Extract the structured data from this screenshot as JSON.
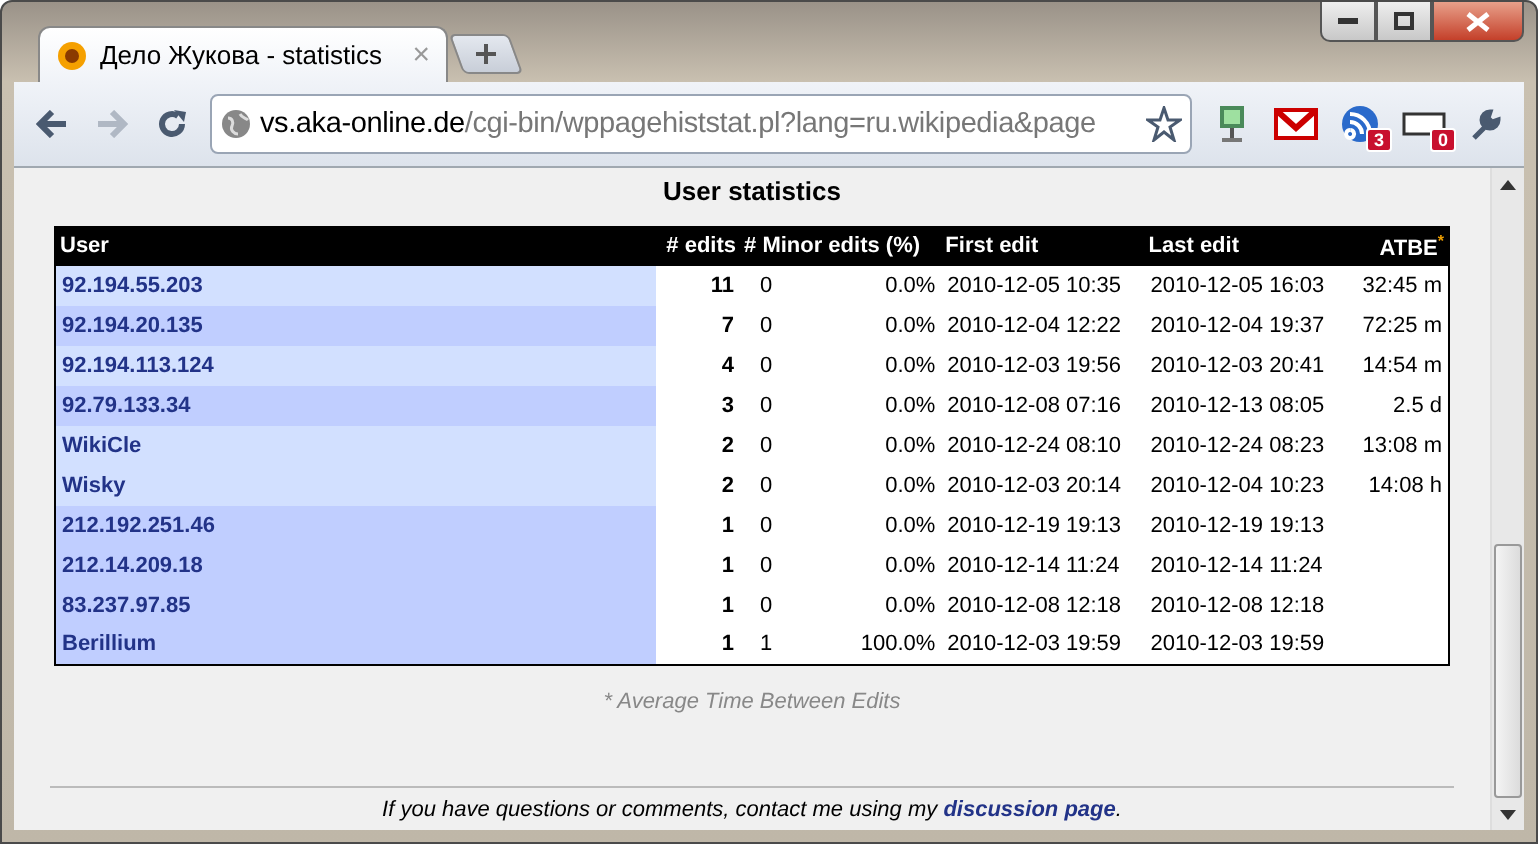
{
  "tab": {
    "title": "Дело Жукова - statistics",
    "close": "×"
  },
  "address": {
    "host": "vs.aka-online.de",
    "path": "/cgi-bin/wppagehiststat.pl?lang=ru.wikipedia&page"
  },
  "extensions": [
    {
      "kind": "monitor"
    },
    {
      "kind": "mail"
    },
    {
      "kind": "feed",
      "badge": "3"
    },
    {
      "kind": "counter",
      "badge": "0"
    }
  ],
  "heading": "User statistics",
  "table": {
    "columns": [
      "User",
      "# edits",
      "# Minor edits (%)",
      "First edit",
      "Last edit",
      "ATBE"
    ],
    "atbe_mark": "*",
    "rows": [
      {
        "user": "92.194.55.203",
        "edits": "11",
        "minor": "0",
        "percent": "0.0%",
        "first": "2010-12-05 10:35",
        "last": "2010-12-05 16:03",
        "atbe": "32:45 m",
        "highlighted": true
      },
      {
        "user": "92.194.20.135",
        "edits": "7",
        "minor": "0",
        "percent": "0.0%",
        "first": "2010-12-04 12:22",
        "last": "2010-12-04 19:37",
        "atbe": "72:25 m",
        "highlighted": false
      },
      {
        "user": "92.194.113.124",
        "edits": "4",
        "minor": "0",
        "percent": "0.0%",
        "first": "2010-12-03 19:56",
        "last": "2010-12-03 20:41",
        "atbe": "14:54 m",
        "highlighted": true
      },
      {
        "user": "92.79.133.34",
        "edits": "3",
        "minor": "0",
        "percent": "0.0%",
        "first": "2010-12-08 07:16",
        "last": "2010-12-13 08:05",
        "atbe": "2.5 d",
        "highlighted": false
      },
      {
        "user": "WikiCle",
        "edits": "2",
        "minor": "0",
        "percent": "0.0%",
        "first": "2010-12-24 08:10",
        "last": "2010-12-24 08:23",
        "atbe": "13:08 m",
        "highlighted": true
      },
      {
        "user": "Wisky",
        "edits": "2",
        "minor": "0",
        "percent": "0.0%",
        "first": "2010-12-03 20:14",
        "last": "2010-12-04 10:23",
        "atbe": "14:08 h",
        "highlighted": true
      },
      {
        "user": "212.192.251.46",
        "edits": "1",
        "minor": "0",
        "percent": "0.0%",
        "first": "2010-12-19 19:13",
        "last": "2010-12-19 19:13",
        "highlighted": false
      },
      {
        "user": "212.14.209.18",
        "edits": "1",
        "minor": "0",
        "percent": "0.0%",
        "first": "2010-12-14 11:24",
        "last": "2010-12-14 11:24",
        "highlighted": false
      },
      {
        "user": "83.237.97.85",
        "edits": "1",
        "minor": "0",
        "percent": "0.0%",
        "first": "2010-12-08 12:18",
        "last": "2010-12-08 12:18",
        "highlighted": false
      },
      {
        "user": "Berillium",
        "edits": "1",
        "minor": "1",
        "percent": "100.0%",
        "first": "2010-12-03 19:59",
        "last": "2010-12-03 19:59",
        "highlighted": false
      }
    ]
  },
  "footnote": "* Average Time Between Edits",
  "footer": {
    "text": "If you have questions or comments, contact me using my ",
    "link": "discussion page",
    "end": "."
  }
}
